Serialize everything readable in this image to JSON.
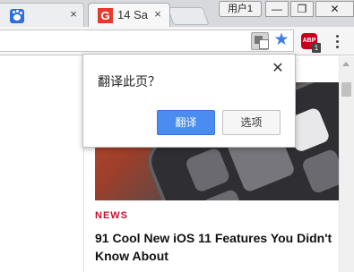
{
  "tabs": [
    {
      "title": "",
      "icon": "baidu-paw-icon",
      "close": "×"
    },
    {
      "title": "14 Sa",
      "icon": "gadgets-g-icon",
      "favicon_letter": "G",
      "close": "×"
    }
  ],
  "titlebar": {
    "user_label": "用户1",
    "minimize": "—",
    "maximize": "❐",
    "close": "✕"
  },
  "toolbar": {
    "translate_icon": "translate-icon",
    "star_icon": "★",
    "adblock": {
      "label": "ABP",
      "badge": "1"
    },
    "menu_icon": "vertical-dots-icon"
  },
  "translate_popup": {
    "title": "翻译此页？",
    "close": "✕",
    "translate_button": "翻译",
    "options_button": "选项"
  },
  "article": {
    "category": "NEWS",
    "headline": "91 Cool New iOS 11 Features You Didn't Know About"
  },
  "colors": {
    "accent_blue": "#4a8cf0",
    "star_blue": "#3e7ae8",
    "news_red": "#c8102e",
    "abp_red": "#c4001b"
  }
}
